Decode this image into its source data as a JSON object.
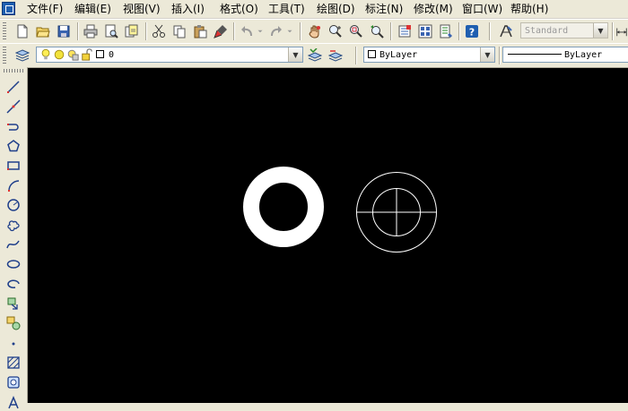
{
  "menu": [
    {
      "label": "文件(F)"
    },
    {
      "label": "编辑(E)"
    },
    {
      "label": "视图(V)"
    },
    {
      "label": "插入(I)"
    },
    {
      "label": "格式(O)"
    },
    {
      "label": "工具(T)"
    },
    {
      "label": "绘图(D)"
    },
    {
      "label": "标注(N)"
    },
    {
      "label": "修改(M)"
    },
    {
      "label": "窗口(W)"
    },
    {
      "label": "帮助(H)"
    }
  ],
  "standard_toolbar": {
    "text_style": "Standard"
  },
  "layers_toolbar": {
    "layer_name": "0",
    "color": "ByLayer",
    "linetype": "ByLayer"
  },
  "canvas": {
    "background": "#000000",
    "entities": [
      {
        "type": "donut",
        "color": "#ffffff"
      },
      {
        "type": "circle",
        "color": "#ffffff"
      },
      {
        "type": "circle",
        "color": "#ffffff"
      },
      {
        "type": "centerline",
        "color": "#ffffff"
      }
    ]
  },
  "icons": {
    "standard": [
      "new-icon",
      "open-icon",
      "save-icon",
      "print-icon",
      "plot-preview-icon",
      "publish-icon",
      "cut-icon",
      "copy-icon",
      "paste-icon",
      "match-properties-icon",
      "undo-icon",
      "redo-icon",
      "pan-icon",
      "zoom-realtime-icon",
      "zoom-window-icon",
      "zoom-previous-icon",
      "properties-icon",
      "design-center-icon",
      "tool-palettes-icon",
      "help-icon",
      "text-style-icon"
    ],
    "draw": [
      "line-icon",
      "construction-line-icon",
      "polyline-icon",
      "polygon-icon",
      "rectangle-icon",
      "arc-icon",
      "circle-icon",
      "revision-cloud-icon",
      "spline-icon",
      "ellipse-icon",
      "ellipse-arc-icon",
      "insert-block-icon",
      "make-block-icon",
      "point-icon",
      "hatch-icon",
      "region-icon",
      "multiline-text-icon"
    ]
  }
}
